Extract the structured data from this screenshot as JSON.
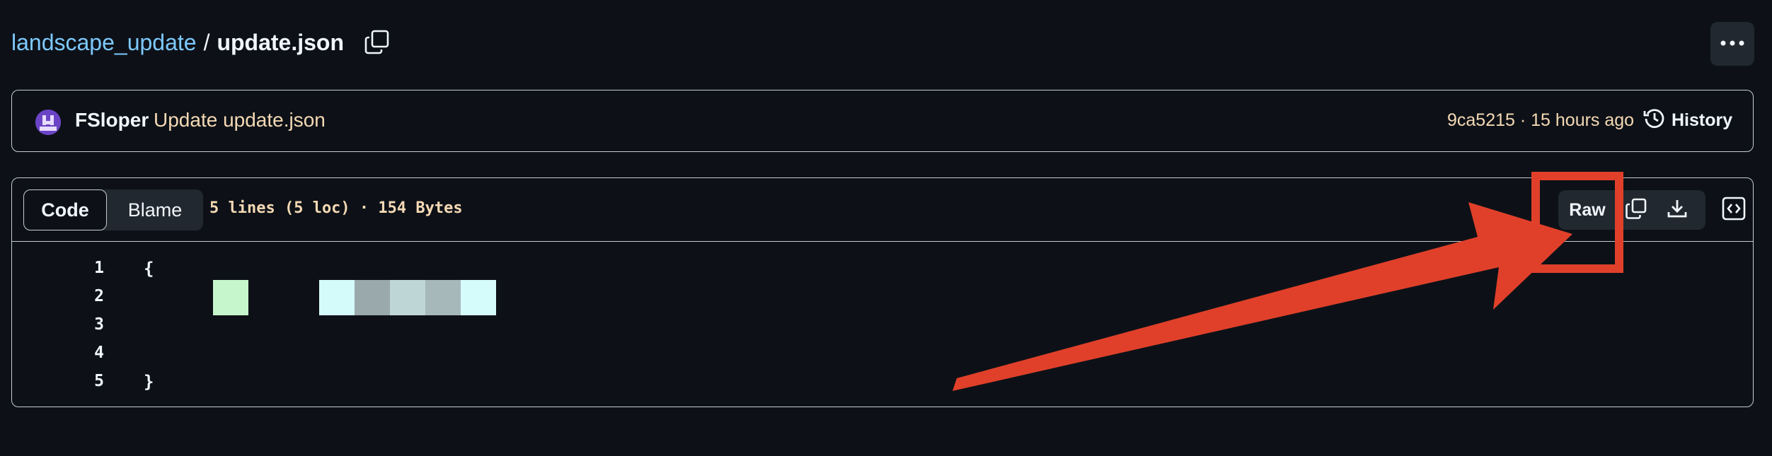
{
  "breadcrumb": {
    "repo": "landscape_update",
    "separator": "/",
    "file": "update.json"
  },
  "commit": {
    "author": "FSloper",
    "message": "Update update.json",
    "meta": "9ca5215 · 15 hours ago",
    "history_label": "History"
  },
  "file_header": {
    "tabs": [
      "Code",
      "Blame"
    ],
    "info": "5 lines (5 loc) · 154 Bytes",
    "raw_label": "Raw"
  },
  "code": {
    "line_numbers": [
      "1",
      "2",
      "3",
      "4",
      "5"
    ],
    "lines": [
      "{",
      "",
      "",
      "",
      "}"
    ]
  },
  "icons": {
    "copy_path": "copy-icon",
    "more": "kebab-horizontal-icon",
    "history": "history-clock-icon",
    "copy_raw": "copy-icon",
    "download": "download-icon",
    "symbols": "code-square-icon"
  },
  "colors": {
    "background": "#0d1117",
    "link": "#7ec9ff",
    "annotation": "#e0402a"
  }
}
